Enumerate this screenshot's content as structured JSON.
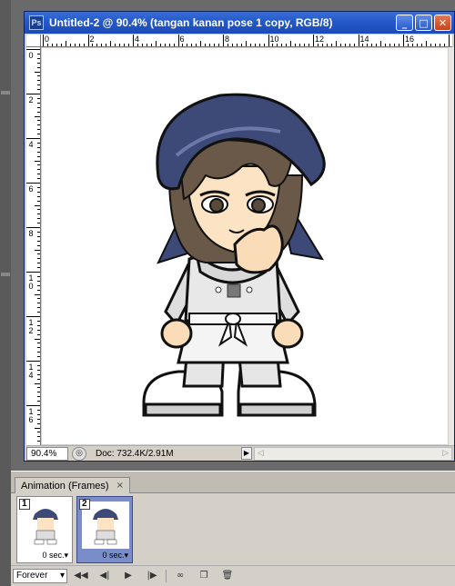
{
  "window": {
    "title": "Untitled-2 @ 90.4% (tangan kanan pose 1 copy, RGB/8)",
    "app_icon_label": "Ps",
    "minimize_icon": "minimize-icon",
    "maximize_icon": "maximize-icon",
    "close_icon": "close-icon"
  },
  "ruler": {
    "top_numbers": [
      "0",
      "2",
      "4",
      "6",
      "8",
      "10",
      "12",
      "14",
      "16"
    ],
    "left_numbers": [
      "0",
      "2",
      "4",
      "6",
      "8",
      "10",
      "12",
      "14",
      "16"
    ]
  },
  "status": {
    "zoom": "90.4%",
    "doc_info": "Doc: 732.4K/2.91M",
    "arrow": "▶",
    "scroll_left": "◁",
    "scroll_right": "▷"
  },
  "animation_panel": {
    "tab_label": "Animation (Frames)",
    "tab_close": "×",
    "frames": [
      {
        "number": "1",
        "delay": "0 sec.",
        "selected": false
      },
      {
        "number": "2",
        "delay": "0 sec.",
        "selected": true
      }
    ],
    "loop_option": "Forever",
    "toolbar_icons": [
      "first-frame-icon",
      "previous-frame-icon",
      "play-icon",
      "next-frame-icon",
      "tween-icon",
      "duplicate-frame-icon",
      "delete-frame-icon"
    ]
  },
  "colors": {
    "titlebar": "#2458c8",
    "bandana": "#3d4a78",
    "hair": "#6a5848",
    "skin": "#fbe3c4",
    "uniform": "#e6e6e6",
    "selected_frame": "#7b8dc8"
  }
}
